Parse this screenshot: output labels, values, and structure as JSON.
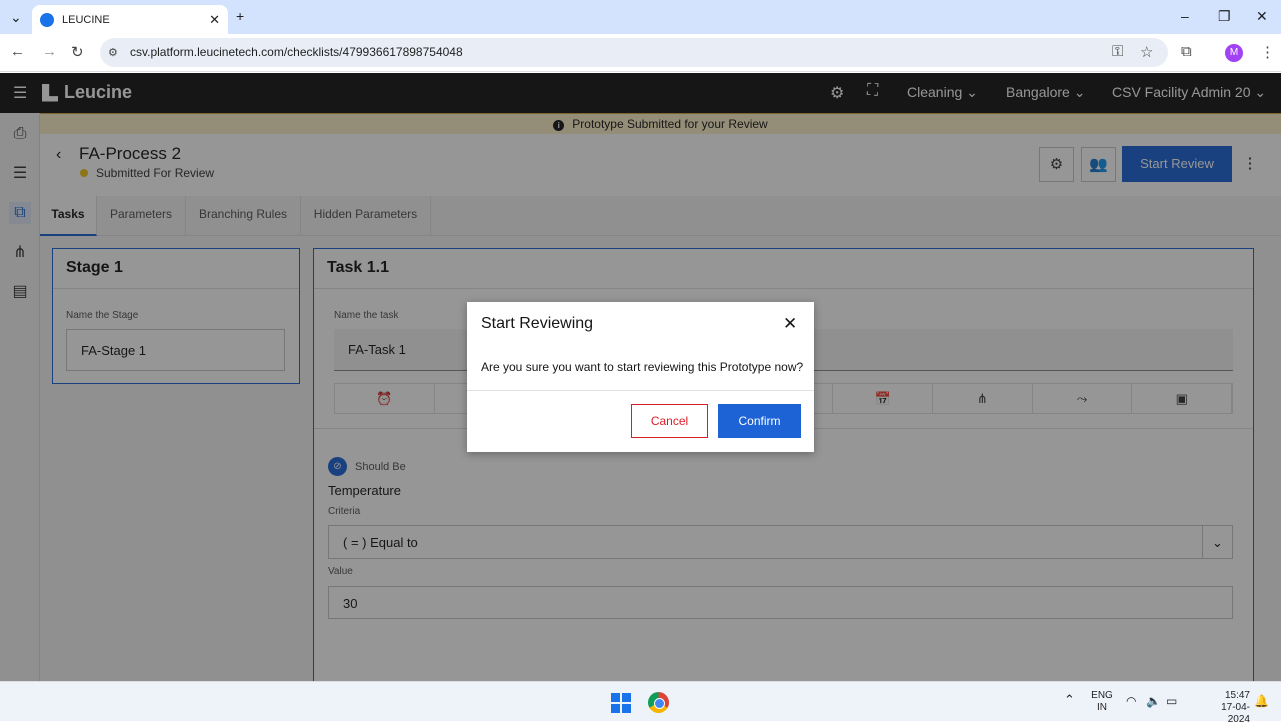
{
  "browser": {
    "tab_title": "LEUCINE",
    "url": "csv.platform.leucinetech.com/checklists/479936617898754048",
    "profile_initial": "M"
  },
  "header": {
    "brand": "Leucine",
    "facility_type": "Cleaning",
    "location": "Bangalore",
    "user": "CSV Facility Admin 20"
  },
  "banner": {
    "text": "Prototype Submitted for your Review"
  },
  "page": {
    "title": "FA-Process 2",
    "status": "Submitted For Review",
    "start_review_label": "Start Review"
  },
  "tabs": [
    {
      "label": "Tasks"
    },
    {
      "label": "Parameters"
    },
    {
      "label": "Branching Rules"
    },
    {
      "label": "Hidden Parameters"
    }
  ],
  "stage": {
    "heading": "Stage 1",
    "name_label": "Name the Stage",
    "name_value": "FA-Stage 1"
  },
  "task": {
    "heading": "Task 1.1",
    "name_label": "Name the task",
    "name_value": "FA-Task 1",
    "parameter": {
      "type_label": "Should Be",
      "name": "Temperature",
      "criteria_label": "Criteria",
      "criteria_value": "( = ) Equal to",
      "value_label": "Value",
      "value": "30"
    }
  },
  "modal": {
    "title": "Start Reviewing",
    "message": "Are you sure you want to start reviewing this Prototype now?",
    "cancel_label": "Cancel",
    "confirm_label": "Confirm"
  },
  "taskbar": {
    "lang_line1": "ENG",
    "lang_line2": "IN",
    "time": "15:47",
    "date": "17-04-2024"
  },
  "colors": {
    "primary": "#1d63d6",
    "danger": "#da1e28",
    "banner_bg": "#fcefc9",
    "header_bg": "#161616"
  }
}
